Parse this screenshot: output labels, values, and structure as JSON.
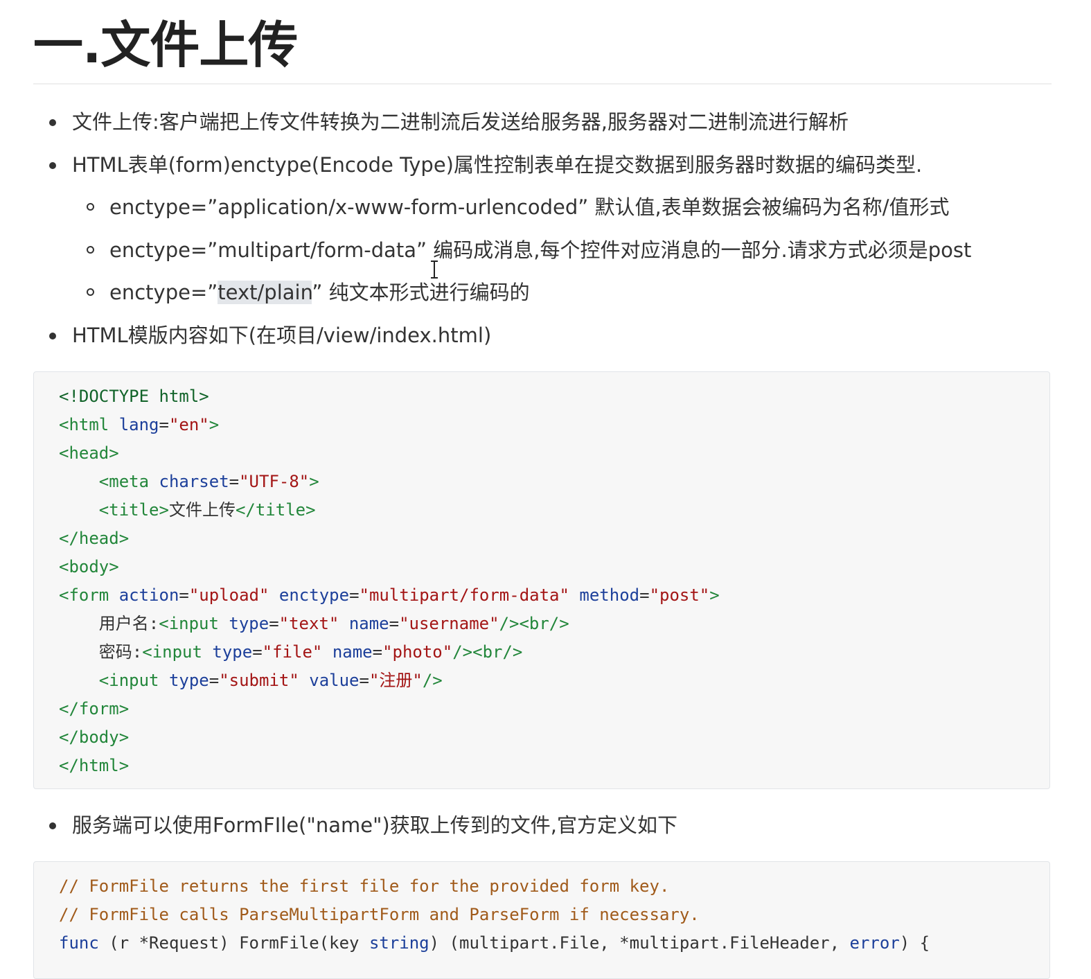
{
  "heading": "一.文件上传",
  "bullets": [
    "文件上传:客户端把上传文件转换为二进制流后发送给服务器,服务器对二进制流进行解析",
    "HTML表单(form)enctype(Encode Type)属性控制表单在提交数据到服务器时数据的编码类型."
  ],
  "sub_items": {
    "item1": "enctype=”application/x-www-form-urlencoded” 默认值,表单数据会被编码为名称/值形式",
    "item2": "enctype=”multipart/form-data” 编码成消息,每个控件对应消息的一部分.请求方式必须是post",
    "item3_prefix": "enctype=”",
    "item3_highlight": "text/plain",
    "item3_suffix": "” 纯文本形式进行编码的"
  },
  "bullet3": "HTML模版内容如下(在项目/view/index.html)",
  "bullet4": "服务端可以使用FormFIle(\"name\")获取上传到的文件,官方定义如下",
  "code1": {
    "l1": "<!DOCTYPE html>",
    "l2_tag": "<html",
    "l2_attr": "lang",
    "l2_eq": "=",
    "l2_val": "\"en\"",
    "l2_end": ">",
    "l3": "<head>",
    "l4_tag": "<meta",
    "l4_attr": "charset",
    "l4_eq": "=",
    "l4_val": "\"UTF-8\"",
    "l4_end": ">",
    "l5_open": "<title>",
    "l5_text": "文件上传",
    "l5_close": "</title>",
    "l6": "</head>",
    "l7": "<body>",
    "l8_tag": "<form",
    "l8_a1": "action",
    "l8_v1": "\"upload\"",
    "l8_a2": "enctype",
    "l8_v2": "\"multipart/form-data\"",
    "l8_a3": "method",
    "l8_v3": "\"post\"",
    "l8_end": ">",
    "l9_label": "用户名:",
    "l9_tag": "<input",
    "l9_a1": "type",
    "l9_v1": "\"text\"",
    "l9_a2": "name",
    "l9_v2": "\"username\"",
    "l9_end": "/><br/>",
    "l10_label": "密码:",
    "l10_tag": "<input",
    "l10_a1": "type",
    "l10_v1": "\"file\"",
    "l10_a2": "name",
    "l10_v2": "\"photo\"",
    "l10_end": "/><br/>",
    "l11_tag": "<input",
    "l11_a1": "type",
    "l11_v1": "\"submit\"",
    "l11_a2": "value",
    "l11_v2": "\"注册\"",
    "l11_end": "/>",
    "l12": "</form>",
    "l13": "</body>",
    "l14": "</html>"
  },
  "code2": {
    "c1": "// FormFile returns the first file for the provided form key.",
    "c2": "// FormFile calls ParseMultipartForm and ParseForm if necessary.",
    "f_kw": "func",
    "f_recv_open": " (r ",
    "f_recv_type": "*Request",
    "f_name": ") FormFile(key ",
    "f_str": "string",
    "f_ret": ") (multipart.File, *multipart.FileHeader, ",
    "f_err": "error",
    "f_end": ") {"
  }
}
